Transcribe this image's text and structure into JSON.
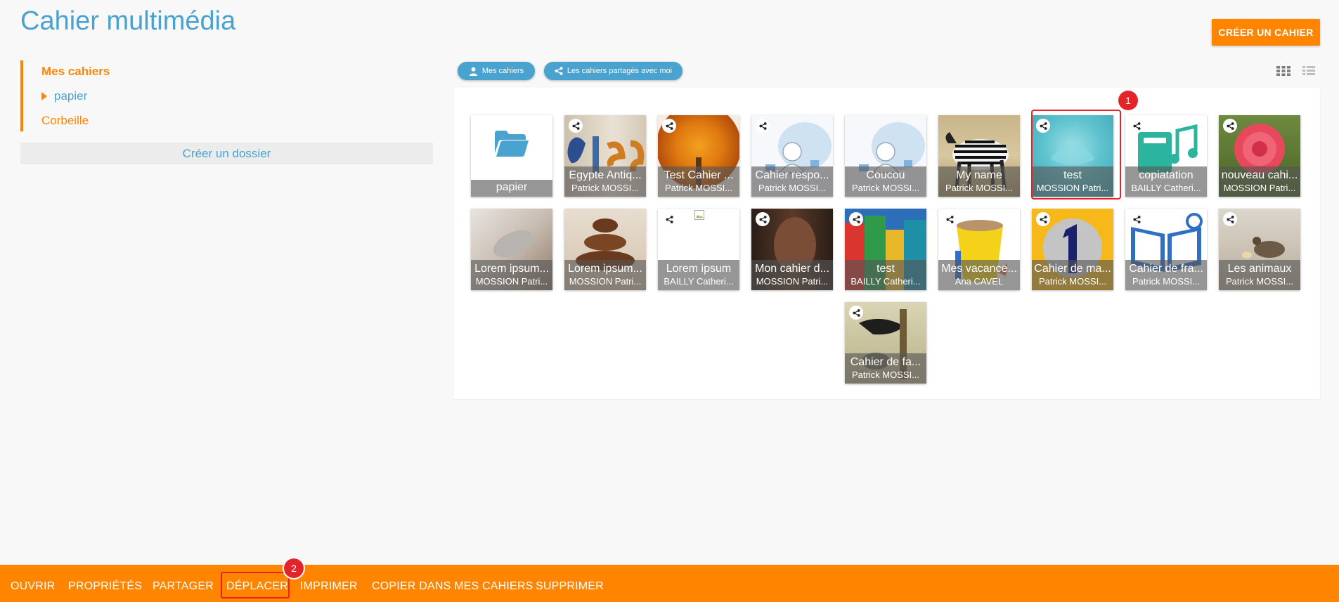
{
  "header": {
    "title": "Cahier multimédia",
    "create_label": "CRÉER UN CAHIER"
  },
  "sidebar": {
    "items": [
      {
        "label": "Mes cahiers",
        "active": true
      },
      {
        "label": "papier",
        "expandable": true
      },
      {
        "label": "Corbeille"
      }
    ],
    "create_folder_label": "Créer un dossier"
  },
  "filters": {
    "mine_label": "Mes cahiers",
    "shared_label": "Les cahiers partagés avec moi"
  },
  "view_modes": [
    "grid-view-icon",
    "list-view-icon"
  ],
  "folder": {
    "name": "papier"
  },
  "notebooks": [
    {
      "title": "Egypte Antiq...",
      "owner": "Patrick MOSSI...",
      "shared": true
    },
    {
      "title": "Test Cahier ...",
      "owner": "Patrick MOSSI...",
      "shared": true
    },
    {
      "title": "Cahier respo...",
      "owner": "Patrick MOSSI...",
      "shared": true
    },
    {
      "title": "Coucou",
      "owner": "Patrick MOSSI...",
      "shared": false
    },
    {
      "title": "My name",
      "owner": "Patrick MOSSI...",
      "shared": false
    },
    {
      "title": "test",
      "owner": "MOSSION Patri...",
      "shared": true,
      "selected": true
    },
    {
      "title": "copiatation",
      "owner": "BAILLY Catheri...",
      "shared": true
    },
    {
      "title": "nouveau cahi...",
      "owner": "MOSSION Patri...",
      "shared": true
    },
    {
      "title": "Lorem ipsum...",
      "owner": "MOSSION Patri...",
      "shared": false
    },
    {
      "title": "Lorem ipsum...",
      "owner": "MOSSION Patri...",
      "shared": false
    },
    {
      "title": "Lorem ipsum",
      "owner": "BAILLY Catheri...",
      "shared": true
    },
    {
      "title": "Mon cahier d...",
      "owner": "MOSSION Patri...",
      "shared": true
    },
    {
      "title": "test",
      "owner": "BAILLY Catheri...",
      "shared": true
    },
    {
      "title": "Mes vacance...",
      "owner": "Ana CAVEL",
      "shared": true
    },
    {
      "title": "Cahier de ma...",
      "owner": "Patrick MOSSI...",
      "shared": true
    },
    {
      "title": "Cahier de fra...",
      "owner": "Patrick MOSSI...",
      "shared": true
    },
    {
      "title": "Les animaux",
      "owner": "Patrick MOSSI...",
      "shared": true
    },
    {
      "title": "Cahier de fa...",
      "owner": "Patrick MOSSI...",
      "shared": true
    }
  ],
  "markers": {
    "badge1": "1",
    "badge2": "2"
  },
  "toolbar": {
    "open": "OUVRIR",
    "properties": "PROPRIÉTÉS",
    "share": "PARTAGER",
    "move": "DÉPLACER",
    "print": "IMPRIMER",
    "copy": "COPIER DANS MES CAHIERS",
    "delete": "SUPPRIMER"
  },
  "colors": {
    "accent": "#ff8500",
    "primary": "#4aa3cf",
    "highlight": "#e3242b"
  }
}
